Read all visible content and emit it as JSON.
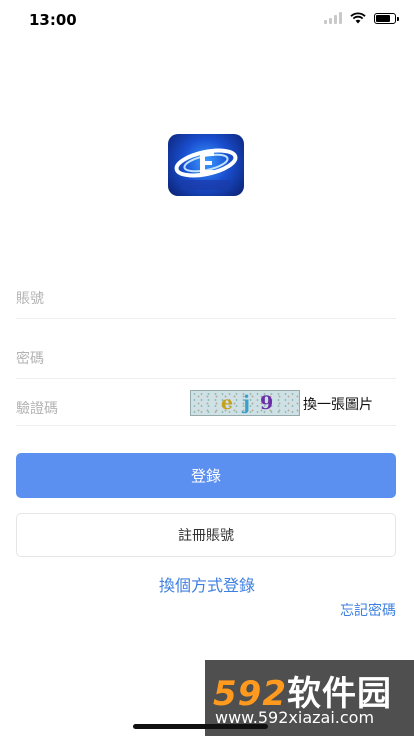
{
  "status_bar": {
    "time": "13:00"
  },
  "logo": {
    "icon": "app-logo-icon",
    "colors": [
      "#3a9bff",
      "#1a4fd0",
      "#0b1f6e"
    ]
  },
  "form": {
    "account_placeholder": "賬號",
    "password_placeholder": "密碼",
    "captcha_placeholder": "驗證碼",
    "captcha_text": [
      "e",
      "j",
      "9"
    ],
    "refresh_label": "換一張圖片"
  },
  "buttons": {
    "login_label": "登錄",
    "register_label": "註冊賬號"
  },
  "links": {
    "alt_login": "換個方式登錄",
    "forgot_password": "忘記密碼"
  },
  "watermark": {
    "brand_num": "592",
    "brand_text": "软件园",
    "url": "www.592xiazai.com"
  },
  "colors": {
    "primary": "#5b8ff0",
    "link": "#3d7fe0"
  }
}
